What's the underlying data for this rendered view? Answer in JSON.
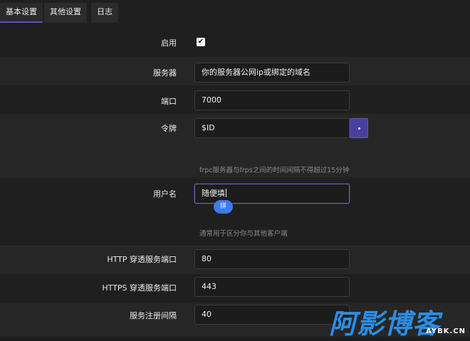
{
  "tabs": [
    {
      "label": "基本设置",
      "active": true
    },
    {
      "label": "其他设置",
      "active": false
    },
    {
      "label": "日志",
      "active": false
    }
  ],
  "form": {
    "enable": {
      "label": "启用",
      "checked": true
    },
    "server": {
      "label": "服务器",
      "value": "你的服务器公网ip或绑定的域名"
    },
    "port": {
      "label": "端口",
      "value": "7000"
    },
    "token": {
      "label": "令牌",
      "value": "$ID",
      "hint": "frpc服务器与frps之间的时间间隔不得超过15分钟"
    },
    "username": {
      "label": "用户名",
      "value": "随便填",
      "hint": "通常用于区分你与其他客户端",
      "ime_badge": "拼"
    },
    "http_port": {
      "label": "HTTP 穿透服务端口",
      "value": "80"
    },
    "https_port": {
      "label": "HTTPS 穿透服务端口",
      "value": "443"
    },
    "heartbeat": {
      "label": "服务注册间隔",
      "value": "40"
    }
  },
  "watermark": {
    "logo_text": "阿影博客",
    "domain": "AYBK.CN"
  },
  "colors": {
    "accent": "#5a4fc0",
    "background": "#1f1f1f",
    "watermark": "#2a8ee6"
  }
}
